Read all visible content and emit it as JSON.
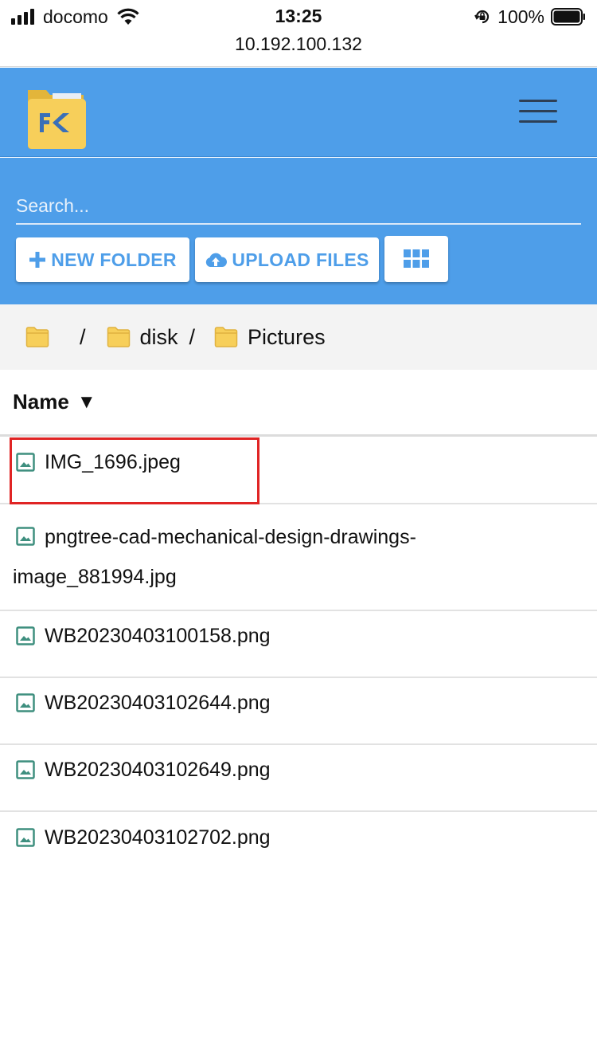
{
  "status_bar": {
    "carrier": "docomo",
    "time": "13:25",
    "url": "10.192.100.132",
    "battery_percent": "100%"
  },
  "header": {
    "logo_text": "FK"
  },
  "toolbar": {
    "search_placeholder": "Search...",
    "new_folder_label": "NEW FOLDER",
    "upload_files_label": "UPLOAD FILES"
  },
  "breadcrumb": {
    "root_separator": "/",
    "items": [
      {
        "label": "disk",
        "separator": "/"
      },
      {
        "label": "Pictures"
      }
    ]
  },
  "list": {
    "sort_column": "Name",
    "sort_indicator": "▼",
    "files": [
      {
        "name": "IMG_1696.jpeg"
      },
      {
        "name_line1": "pngtree-cad-mechanical-design-drawings-",
        "name_line2": "image_881994.jpg"
      },
      {
        "name": "WB20230403100158.png"
      },
      {
        "name": "WB20230403102644.png"
      },
      {
        "name": "WB20230403102649.png"
      },
      {
        "name": "WB20230403102702.png"
      }
    ]
  },
  "colors": {
    "accent": "#4e9ee9",
    "folder": "#f7cf5a",
    "file_icon": "#3f8f7f",
    "highlight": "#e02424"
  }
}
